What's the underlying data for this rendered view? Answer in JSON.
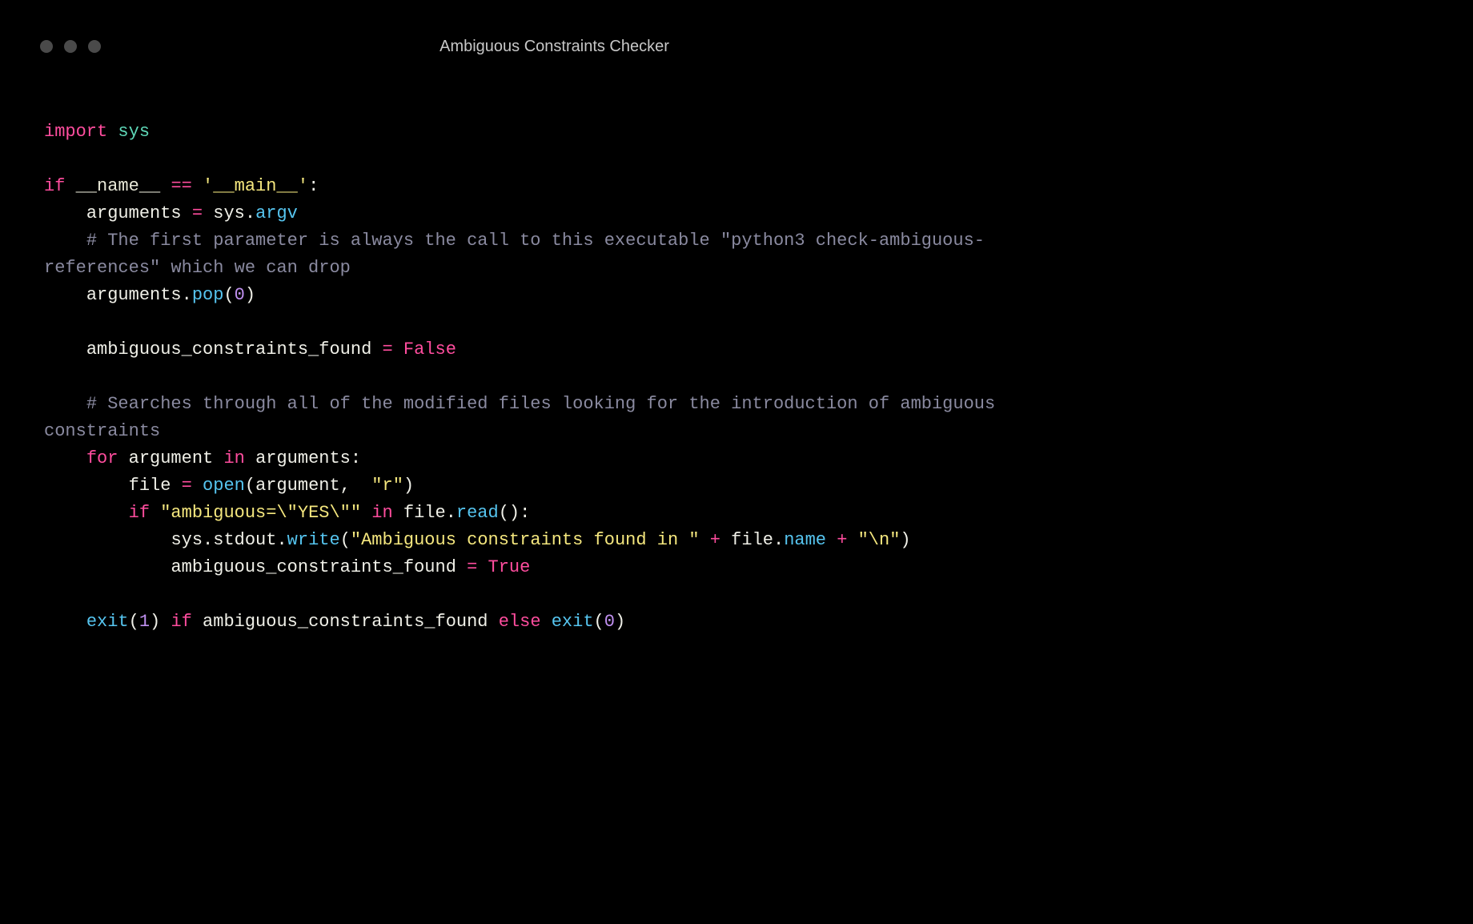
{
  "window": {
    "title": "Ambiguous Constraints Checker"
  },
  "code": {
    "line1_import": "import",
    "line1_sys": "sys",
    "line3_if": "if",
    "line3_name": "__name__",
    "line3_eq": "==",
    "line3_main": "'__main__'",
    "line3_colon": ":",
    "line4_arguments": "arguments",
    "line4_eq": "=",
    "line4_sys": "sys",
    "line4_dot": ".",
    "line4_argv": "argv",
    "line5_comment": "# The first parameter is always the call to this executable \"python3 check-ambiguous-references\" which we can drop",
    "line6_arguments": "arguments",
    "line6_dot": ".",
    "line6_pop": "pop",
    "line6_open": "(",
    "line6_zero": "0",
    "line6_close": ")",
    "line8_varname": "ambiguous_constraints_found",
    "line8_eq": "=",
    "line8_false": "False",
    "line10_comment": "# Searches through all of the modified files looking for the introduction of ambiguous constraints",
    "line11_for": "for",
    "line11_argument": "argument",
    "line11_in": "in",
    "line11_arguments": "arguments",
    "line11_colon": ":",
    "line12_file": "file",
    "line12_eq": "=",
    "line12_open": "open",
    "line12_paren_o": "(",
    "line12_argument": "argument",
    "line12_comma": ",",
    "line12_r": "\"r\"",
    "line12_paren_c": ")",
    "line13_if": "if",
    "line13_str": "\"ambiguous=\\\"YES\\\"\"",
    "line13_in": "in",
    "line13_file": "file",
    "line13_dot": ".",
    "line13_read": "read",
    "line13_parens": "()",
    "line13_colon": ":",
    "line14_sys": "sys",
    "line14_dot1": ".",
    "line14_stdout": "stdout",
    "line14_dot2": ".",
    "line14_write": "write",
    "line14_paren_o": "(",
    "line14_str1": "\"Ambiguous constraints found in \"",
    "line14_plus1": "+",
    "line14_file": "file",
    "line14_dot3": ".",
    "line14_name": "name",
    "line14_plus2": "+",
    "line14_str2": "\"\\n\"",
    "line14_paren_c": ")",
    "line15_varname": "ambiguous_constraints_found",
    "line15_eq": "=",
    "line15_true": "True",
    "line17_exit1": "exit",
    "line17_p1o": "(",
    "line17_one": "1",
    "line17_p1c": ")",
    "line17_if": "if",
    "line17_var": "ambiguous_constraints_found",
    "line17_else": "else",
    "line17_exit2": "exit",
    "line17_p2o": "(",
    "line17_zero": "0",
    "line17_p2c": ")"
  }
}
